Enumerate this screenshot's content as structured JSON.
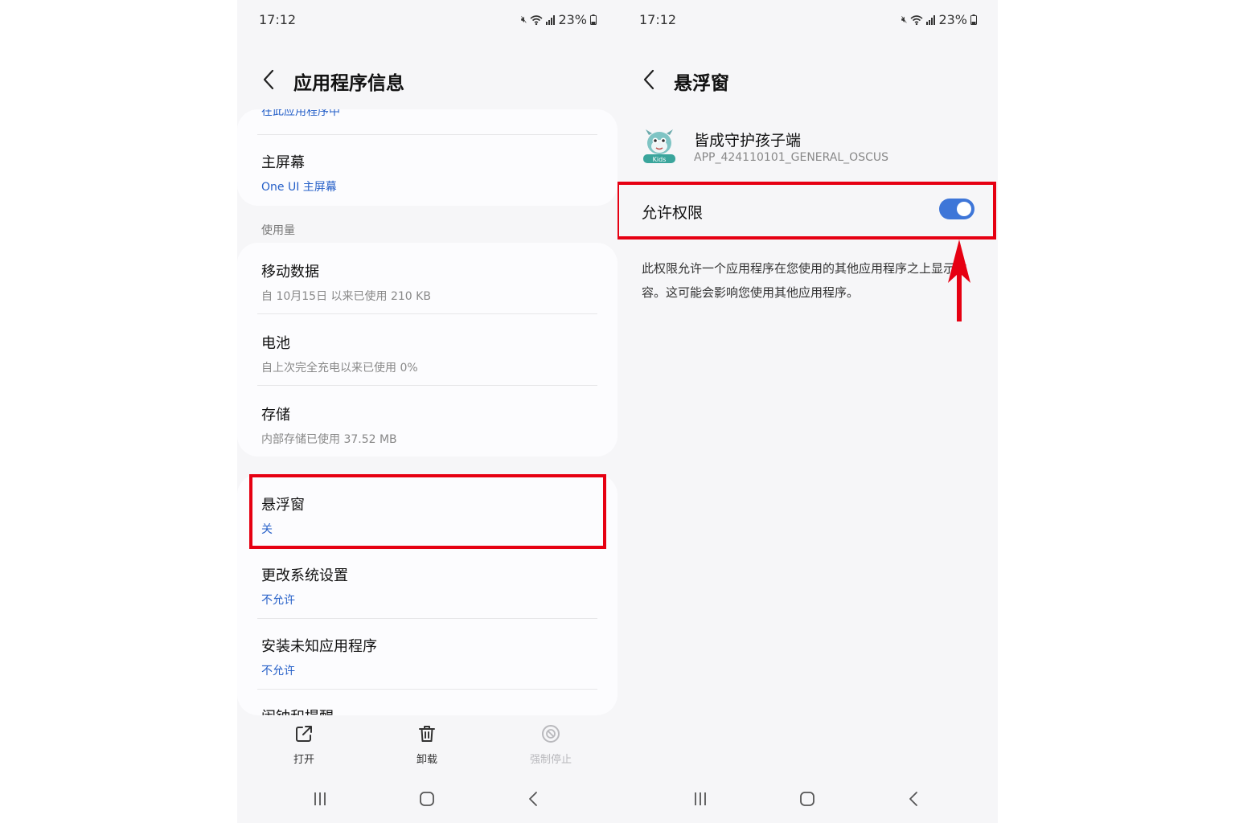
{
  "accent_red": "#e60012",
  "accent_blue": "#3e76d8",
  "left": {
    "status": {
      "time": "17:12",
      "battery": "23%"
    },
    "header": {
      "title": "应用程序信息"
    },
    "partial_top": "在此应用程序中",
    "home_screen": {
      "title": "主屏幕",
      "value": "One UI 主屏幕"
    },
    "usage": {
      "section_label": "使用量",
      "items": [
        {
          "title": "移动数据",
          "subtitle": "自 10月15日 以来已使用 210 KB"
        },
        {
          "title": "电池",
          "subtitle": "自上次完全充电以来已使用 0%"
        },
        {
          "title": "存储",
          "subtitle": "内部存储已使用 37.52 MB"
        }
      ]
    },
    "permissions": [
      {
        "title": "悬浮窗",
        "value": "关"
      },
      {
        "title": "更改系统设置",
        "value": "不允许"
      },
      {
        "title": "安装未知应用程序",
        "value": "不允许"
      }
    ],
    "partial_bottom": "闹钟和提醒",
    "actions": {
      "open": "打开",
      "uninstall": "卸载",
      "force_stop": "强制停止"
    }
  },
  "right": {
    "status": {
      "time": "17:12",
      "battery": "23%"
    },
    "header": {
      "title": "悬浮窗"
    },
    "app": {
      "name": "皆成守护孩子端",
      "id": "APP_424110101_GENERAL_OSCUS",
      "icon_badge": "Kids"
    },
    "permission": {
      "label": "允许权限",
      "enabled": true
    },
    "description": "此权限允许一个应用程序在您使用的其他应用程序之上显示内容。这可能会影响您使用其他应用程序。"
  }
}
